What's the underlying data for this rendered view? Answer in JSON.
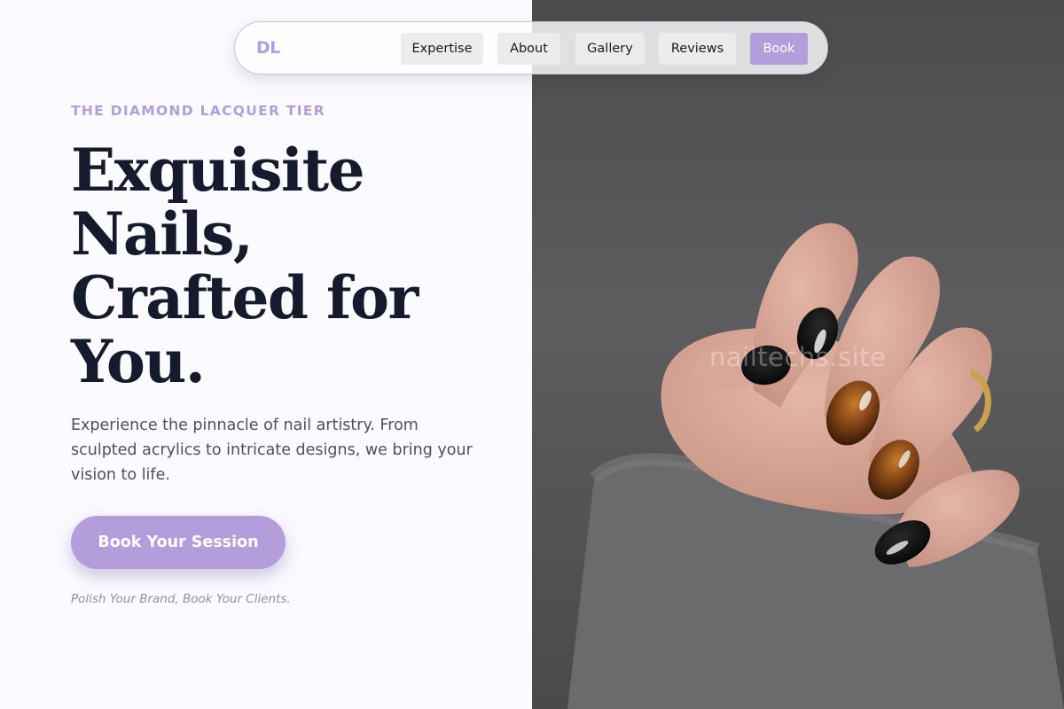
{
  "nav": {
    "logo": "DL",
    "links": [
      {
        "label": "Expertise"
      },
      {
        "label": "About"
      },
      {
        "label": "Gallery"
      },
      {
        "label": "Reviews"
      },
      {
        "label": "Book"
      }
    ]
  },
  "hero": {
    "eyebrow": "THE DIAMOND LACQUER TIER",
    "headline_lines": [
      "Exquisite",
      "Nails,",
      "Crafted for",
      "You."
    ],
    "description": "Experience the pinnacle of nail artistry. From sculpted acrylics to intricate designs, we bring your vision to life.",
    "cta_label": "Book Your Session",
    "tagline": "Polish Your Brand, Book Your Clients."
  },
  "photo": {
    "watermark": "nailtechs.site",
    "alt": "hand with black and tortoiseshell manicure in grey knit sweater"
  },
  "colors": {
    "accent": "#b39ddb",
    "headline": "#151a2d",
    "background": "#fbfaff"
  }
}
